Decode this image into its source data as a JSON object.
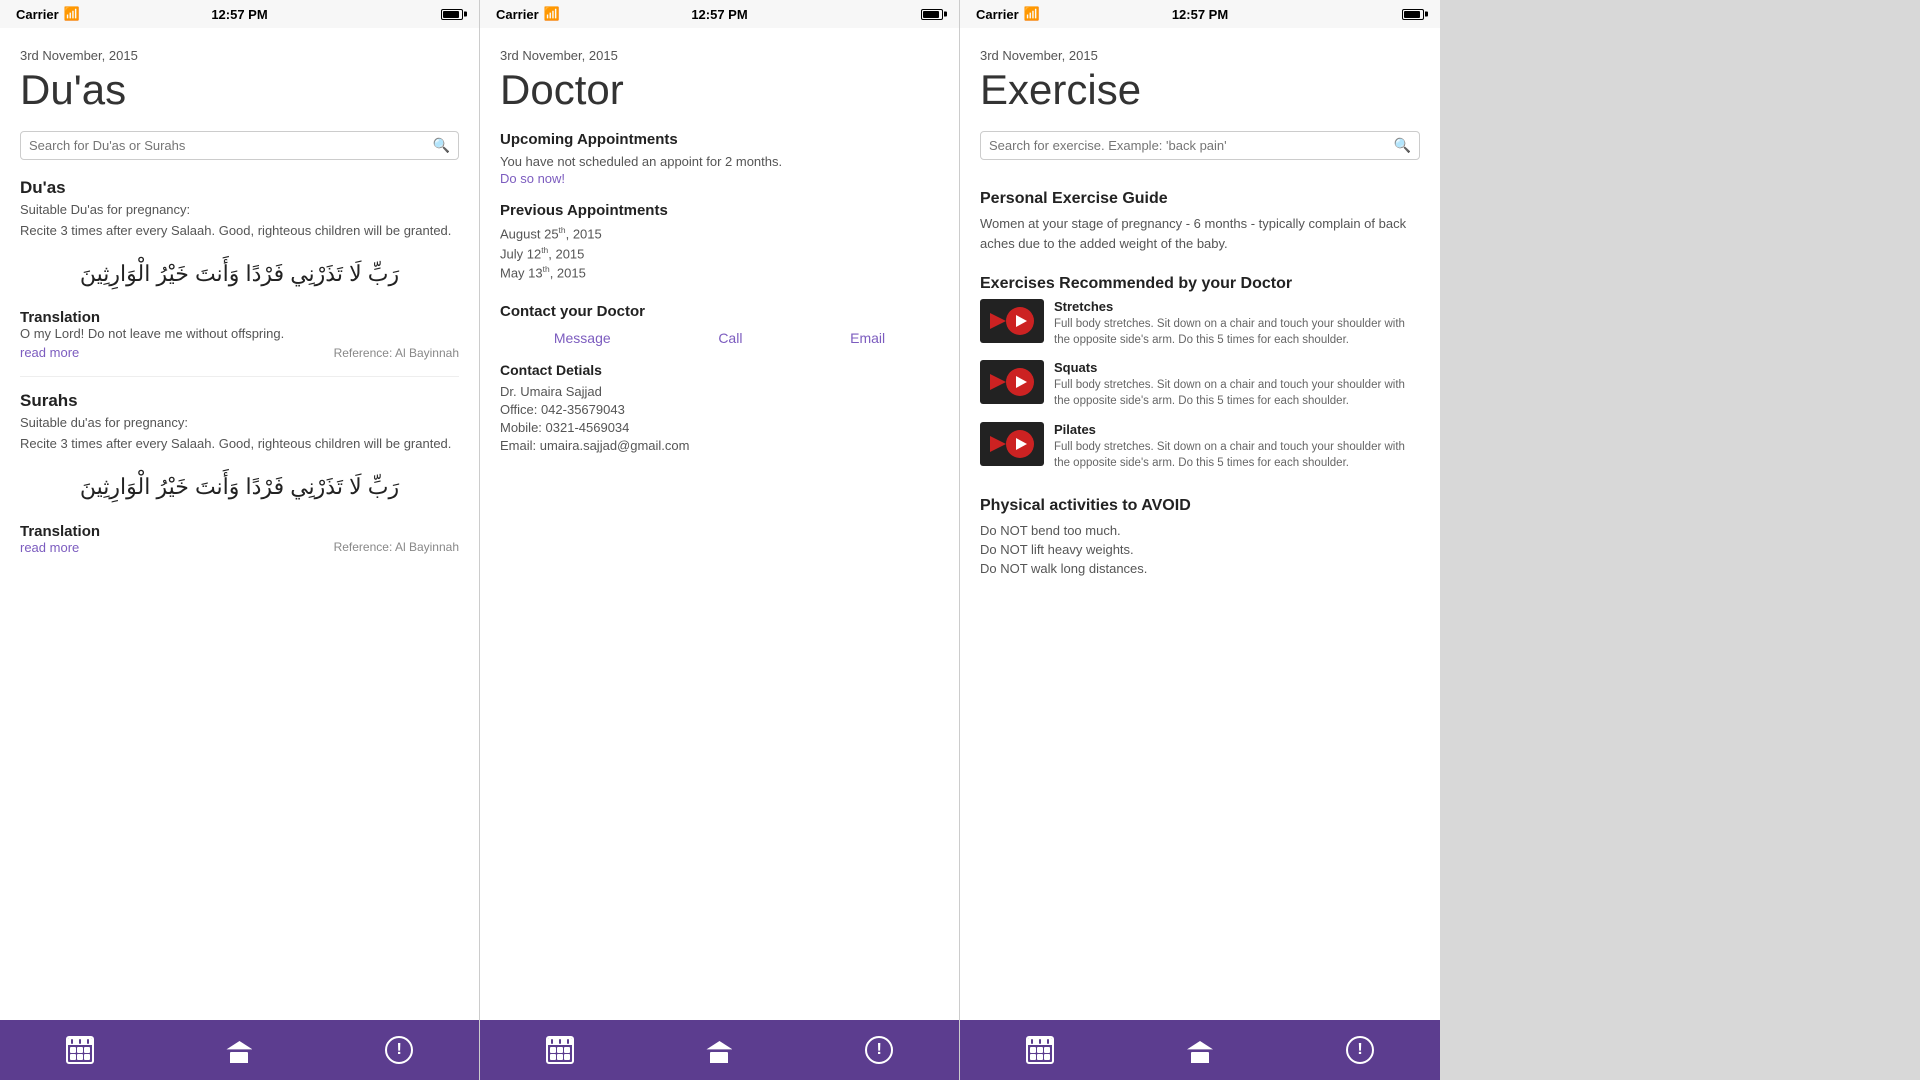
{
  "screens": [
    {
      "id": "duas",
      "statusBar": {
        "carrier": "Carrier",
        "time": "12:57 PM"
      },
      "date": "3rd November, 2015",
      "title": "Du'as",
      "search": {
        "placeholder": "Search for Du'as or Surahs"
      },
      "section1": {
        "title": "Du'as",
        "subtitle": "Suitable Du'as for pregnancy:",
        "body": "Recite 3 times after every Salaah. Good, righteous children will be granted.",
        "arabic": "رَبِّ لَا تَذَرْنِي فَرْدًا وَأَنتَ خَيْرُ الْوَارِثِينَ",
        "translationLabel": "Translation",
        "translationText": "O my Lord! Do not leave me without offspring.",
        "readMore": "read more",
        "reference": "Reference: Al Bayinnah"
      },
      "section2": {
        "title": "Surahs",
        "subtitle": "Suitable du'as for pregnancy:",
        "body": "Recite 3 times after every Salaah. Good, righteous children will be granted.",
        "arabic": "رَبِّ لَا تَذَرْنِي فَرْدًا وَأَنتَ خَيْرُ الْوَارِثِينَ",
        "translationLabel": "Translation",
        "translationText": "",
        "readMore": "read more",
        "reference": "Reference: Al Bayinnah"
      },
      "bottomBar": {
        "icons": [
          "calendar",
          "home",
          "exclaim"
        ]
      }
    },
    {
      "id": "doctor",
      "statusBar": {
        "carrier": "Carrier",
        "time": "12:57 PM"
      },
      "date": "3rd November, 2015",
      "title": "Doctor",
      "upcoming": {
        "title": "Upcoming Appointments",
        "text": "You have not scheduled an appoint for 2 months.",
        "link": "Do so now!"
      },
      "previous": {
        "title": "Previous Appointments",
        "dates": [
          "August 25th, 2015",
          "July 12th, 2015",
          "May 13th, 2015"
        ]
      },
      "contact": {
        "title": "Contact your Doctor",
        "actions": [
          "Message",
          "Call",
          "Email"
        ],
        "detailsTitle": "Contact Detials",
        "details": [
          "Dr. Umaira Sajjad",
          "Office: 042-35679043",
          "Mobile: 0321-4569034",
          "Email: umaira.sajjad@gmail.com"
        ]
      },
      "bottomBar": {
        "icons": [
          "calendar",
          "home",
          "exclaim"
        ]
      }
    },
    {
      "id": "exercise",
      "statusBar": {
        "carrier": "Carrier",
        "time": "12:57 PM"
      },
      "date": "3rd November, 2015",
      "title": "Exercise",
      "search": {
        "placeholder": "Search for exercise. Example: 'back pain'"
      },
      "personalGuide": {
        "title": "Personal Exercise Guide",
        "desc": "Women at your stage of pregnancy - 6 months - typically complain of back aches due to the added weight of the baby."
      },
      "recommended": {
        "title": "Exercises Recommended by your Doctor",
        "items": [
          {
            "label": "Stretches",
            "desc": "Full body stretches. Sit down on a chair and touch your shoulder with the opposite side's arm.\nDo this 5 times for each shoulder."
          },
          {
            "label": "Squats",
            "desc": "Full body stretches. Sit down on a chair and touch your shoulder with the opposite side's arm.\nDo this 5 times for each shoulder."
          },
          {
            "label": "Pilates",
            "desc": "Full body stretches. Sit down on a chair and touch your shoulder with the opposite side's arm.\nDo this 5 times for each shoulder."
          }
        ]
      },
      "avoid": {
        "title": "Physical activities to AVOID",
        "items": [
          "Do NOT bend too much.",
          "Do NOT lift heavy weights.",
          "Do NOT walk long distances."
        ]
      },
      "bottomBar": {
        "icons": [
          "calendar",
          "home",
          "exclaim"
        ]
      }
    }
  ]
}
